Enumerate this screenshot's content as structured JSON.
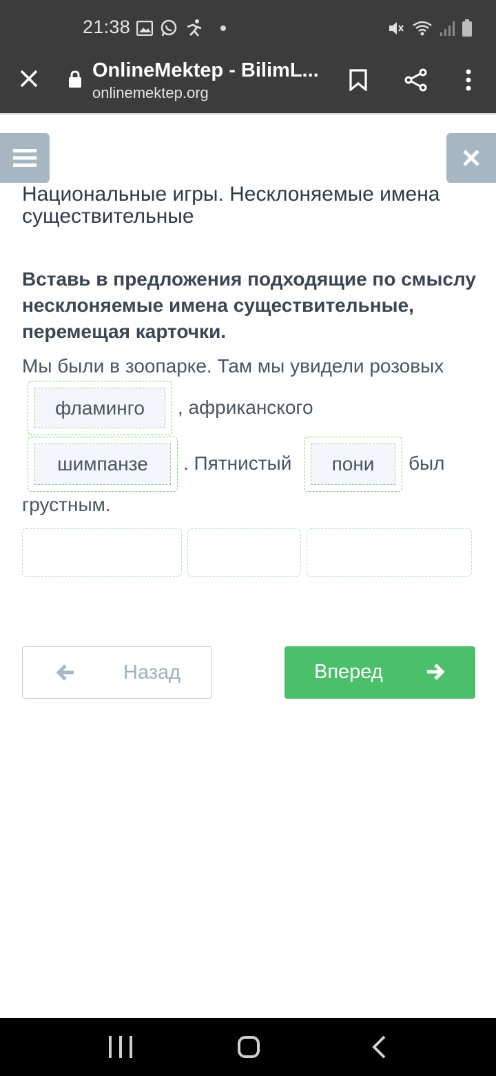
{
  "status_bar": {
    "time": "21:38",
    "left_icons": [
      "image-icon",
      "whatsapp-icon",
      "activity-icon"
    ],
    "right_icons": [
      "mute-icon",
      "wifi-icon",
      "signal-icon",
      "battery-icon"
    ]
  },
  "browser": {
    "title": "OnlineMektep - BilimL...",
    "url": "onlinemektep.org",
    "icons": [
      "close-icon",
      "lock-icon",
      "bookmark-icon",
      "share-icon",
      "more-vert-icon"
    ]
  },
  "page": {
    "lesson_title": "Национальные игры. Несклоняемые имена существительные",
    "instruction": "Вставь в предложения подходящие по смыслу несклоняемые имена существительные, перемещая карточки.",
    "sentence": {
      "part1": "Мы были в зоопарке. Там мы увидели розовых",
      "part2": ", африканского",
      "part3": ". Пятнистый",
      "part4": "был",
      "part5": "грустным."
    },
    "cards": [
      "фламинго",
      "шимпанзе",
      "пони"
    ],
    "card_bank_slots": 3
  },
  "navigation": {
    "back_label": "Назад",
    "next_label": "Вперед"
  },
  "colors": {
    "status_bar": "#3c3c3c",
    "menu_button": "#a6b7c3",
    "next_button": "#4cbf6b",
    "dashed_border": "#7ccf7c",
    "card_background": "#f3f7fb"
  }
}
